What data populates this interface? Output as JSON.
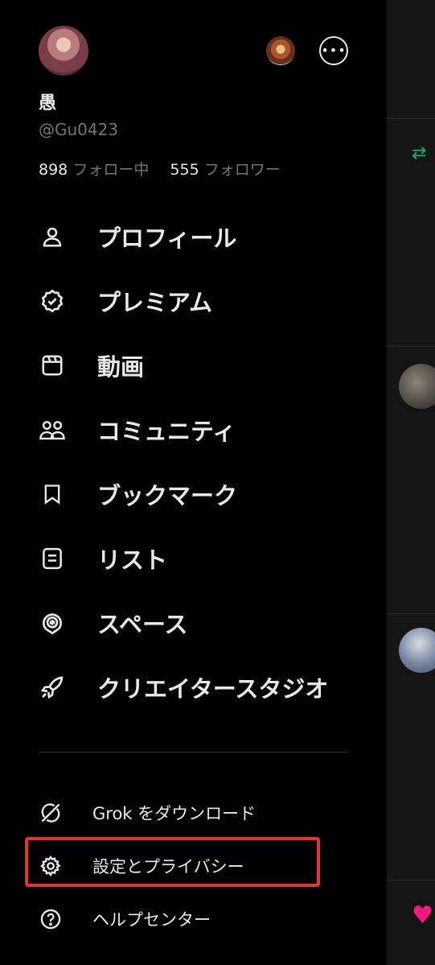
{
  "profile": {
    "name": "愚",
    "handle": "@Gu0423",
    "following_count": "898",
    "following_label": "フォロー中",
    "followers_count": "555",
    "followers_label": "フォロワー"
  },
  "menu": {
    "items": [
      {
        "label": "プロフィール",
        "icon": "person-icon"
      },
      {
        "label": "プレミアム",
        "icon": "verified-badge-icon"
      },
      {
        "label": "動画",
        "icon": "video-icon"
      },
      {
        "label": "コミュニティ",
        "icon": "communities-icon"
      },
      {
        "label": "ブックマーク",
        "icon": "bookmark-icon"
      },
      {
        "label": "リスト",
        "icon": "list-icon"
      },
      {
        "label": "スペース",
        "icon": "spaces-icon"
      },
      {
        "label": "クリエイタースタジオ",
        "icon": "rocket-icon"
      }
    ]
  },
  "secondary": {
    "items": [
      {
        "label": "Grok をダウンロード",
        "icon": "grok-icon"
      },
      {
        "label": "設定とプライバシー",
        "icon": "gear-icon"
      },
      {
        "label": "ヘルプセンター",
        "icon": "help-icon"
      }
    ]
  },
  "colors": {
    "background": "#000000",
    "text": "#e7e9ea",
    "muted": "#71767b",
    "highlight_box": "#e3342f",
    "retweet_green": "#00ba7c",
    "like_pink": "#f91880"
  }
}
